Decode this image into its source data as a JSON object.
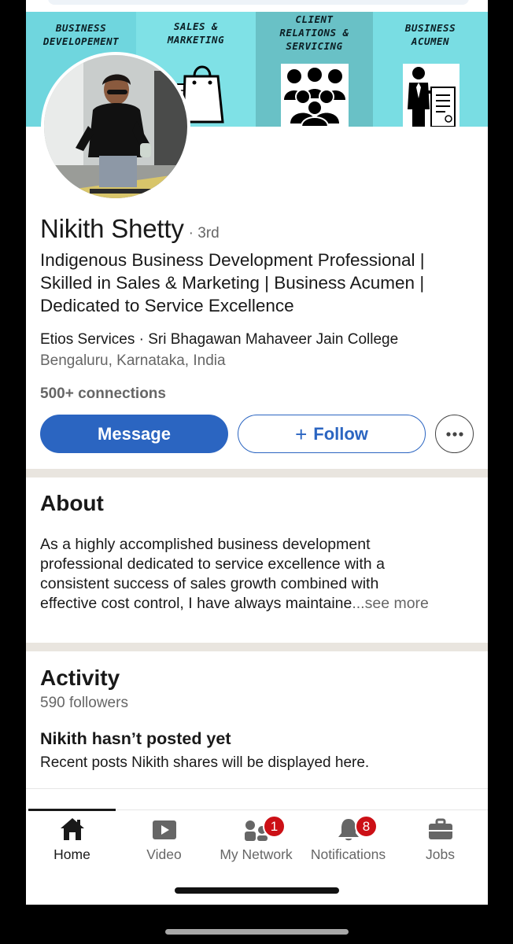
{
  "banner": {
    "segments": [
      {
        "text": "BUSINESS\nDEVELOPEMENT",
        "icon": "none"
      },
      {
        "text": "SALES &\nMARKETING",
        "icon": "shopping-bag-icon"
      },
      {
        "text": "CLIENT\nRELATIONS &\nSERVICING",
        "icon": "people-group-icon"
      },
      {
        "text": "BUSINESS\nACUMEN",
        "icon": "businessman-document-icon"
      }
    ],
    "colors": [
      "#6fd6de",
      "#7fe1e6",
      "#69c1c6",
      "#79dde3"
    ]
  },
  "profile": {
    "name": "Nikith Shetty",
    "degree": "· 3rd",
    "headline_lines": [
      "Indigenous  Business Development Professional  |",
      "Skilled in Sales & Marketing  | Business Acumen |",
      "Dedicated to Service Excellence"
    ],
    "company": "Etios Services · Sri Bhagawan Mahaveer Jain College",
    "location": "Bengaluru, Karnataka, India",
    "connections": "500+ connections"
  },
  "actions": {
    "message_label": "Message",
    "follow_plus": "+",
    "follow_label": "Follow",
    "more_icon": "more-horizontal-icon"
  },
  "about": {
    "title": "About",
    "lines": [
      "As a highly accomplished business development",
      "professional dedicated to service excellence with a",
      "consistent success of sales growth combined with",
      "effective cost control, I have always maintaine"
    ],
    "see_more": "...see more"
  },
  "activity": {
    "title": "Activity",
    "followers": "590 followers",
    "empty_title": "Nikith hasn’t posted yet",
    "empty_subtitle": "Recent posts Nikith shares will be displayed here."
  },
  "nav": {
    "items": [
      {
        "label": "Home",
        "icon": "home-icon",
        "active": true
      },
      {
        "label": "Video",
        "icon": "video-icon",
        "active": false
      },
      {
        "label": "My Network",
        "icon": "network-icon",
        "badge": "1"
      },
      {
        "label": "Notifications",
        "icon": "bell-icon",
        "badge": "8"
      },
      {
        "label": "Jobs",
        "icon": "briefcase-icon",
        "active": false
      }
    ]
  },
  "colors": {
    "accent": "#2b65c1",
    "badge": "#cc1016",
    "divider": "#e9e5df"
  }
}
